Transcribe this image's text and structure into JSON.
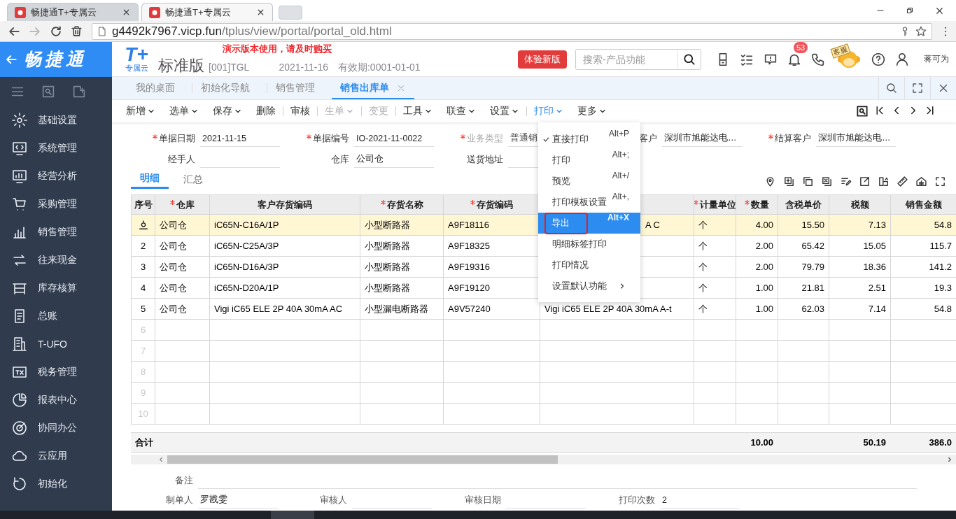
{
  "browser": {
    "tabs": [
      {
        "title": "畅捷通T+专属云",
        "selected": false
      },
      {
        "title": "畅捷通T+专属云",
        "selected": true
      }
    ],
    "url_host": "g4492k7967.vicp.fun",
    "url_path": "/tplus/view/portal/portal_old.html"
  },
  "header": {
    "brand": "畅捷通",
    "product_mark": "T+",
    "product_sub": "专属云",
    "edition": "标准版",
    "account": "[001]TGL",
    "date": "2021-11-16",
    "validity": "有效期:0001-01-01",
    "notice": "演示版本使用，请及时",
    "notice_link": "购买",
    "new_version_button": "体验新版",
    "search": {
      "placeholder": "搜索-产品功能"
    },
    "notification_count": "53",
    "support_label": "客服",
    "user_name": "蒋可为"
  },
  "sidebar": {
    "items": [
      {
        "label": "基础设置"
      },
      {
        "label": "系统管理"
      },
      {
        "label": "经营分析"
      },
      {
        "label": "采购管理"
      },
      {
        "label": "销售管理"
      },
      {
        "label": "往来现金"
      },
      {
        "label": "库存核算"
      },
      {
        "label": "总账"
      },
      {
        "label": "T-UFO"
      },
      {
        "label": "税务管理"
      },
      {
        "label": "报表中心"
      },
      {
        "label": "协同办公"
      },
      {
        "label": "云应用"
      },
      {
        "label": "初始化"
      }
    ]
  },
  "tabs": [
    {
      "label": "我的桌面",
      "selected": false,
      "closable": false
    },
    {
      "label": "初始化导航",
      "selected": false,
      "closable": false
    },
    {
      "label": "销售管理",
      "selected": false,
      "closable": false
    },
    {
      "label": "销售出库单",
      "selected": true,
      "closable": true
    }
  ],
  "toolbar": [
    {
      "label": "新增",
      "dropdown": true,
      "disabled": false,
      "selected": false,
      "separator_before": false
    },
    {
      "label": "选单",
      "dropdown": true,
      "disabled": false,
      "selected": false,
      "separator_before": false
    },
    {
      "label": "保存",
      "dropdown": true,
      "disabled": false,
      "selected": false,
      "separator_before": false
    },
    {
      "label": "删除",
      "dropdown": false,
      "disabled": false,
      "selected": false,
      "separator_before": false
    },
    {
      "label": "审核",
      "dropdown": false,
      "disabled": false,
      "selected": false,
      "separator_before": true
    },
    {
      "label": "生单",
      "dropdown": true,
      "disabled": true,
      "selected": false,
      "separator_before": true
    },
    {
      "label": "变更",
      "dropdown": false,
      "disabled": true,
      "selected": false,
      "separator_before": true
    },
    {
      "label": "工具",
      "dropdown": true,
      "disabled": false,
      "selected": false,
      "separator_before": true
    },
    {
      "label": "联查",
      "dropdown": true,
      "disabled": false,
      "selected": false,
      "separator_before": false
    },
    {
      "label": "设置",
      "dropdown": true,
      "disabled": false,
      "selected": false,
      "separator_before": false
    },
    {
      "label": "打印",
      "dropdown": true,
      "disabled": false,
      "selected": true,
      "separator_before": true
    },
    {
      "label": "更多",
      "dropdown": true,
      "disabled": false,
      "selected": false,
      "separator_before": false
    }
  ],
  "form": {
    "rows": [
      [
        {
          "label": "单据日期",
          "required": true,
          "disabled": false,
          "value": "2021-11-15"
        },
        {
          "label": "单据编号",
          "required": true,
          "disabled": false,
          "value": "IO-2021-11-0022"
        },
        {
          "label": "业务类型",
          "required": true,
          "disabled": true,
          "value": "普通销"
        },
        {
          "label": "客户",
          "disabled": false,
          "value": "深圳市旭能达电…"
        },
        {
          "label": "结算客户",
          "required": true,
          "disabled": false,
          "value": "深圳市旭能达电…"
        }
      ],
      [
        {
          "label": "经手人",
          "required": false,
          "disabled": false
        },
        {
          "label": "仓库",
          "required": false,
          "disabled": false,
          "value": "公司仓"
        },
        {
          "label": "送货地址",
          "required": false,
          "disabled": false
        }
      ]
    ]
  },
  "detail_tabs": [
    {
      "label": "明细",
      "selected": true
    },
    {
      "label": "汇总",
      "selected": false
    }
  ],
  "table": {
    "columns": [
      {
        "label": "序号",
        "required": false
      },
      {
        "label": "仓库",
        "required": true
      },
      {
        "label": "客户存货编码",
        "required": false
      },
      {
        "label": "存货名称",
        "required": true
      },
      {
        "label": "存货编码",
        "required": true
      },
      {},
      {
        "label": "计量单位",
        "required": true
      },
      {
        "label": "数量",
        "required": true
      },
      {
        "label": "含税单价",
        "required": false
      },
      {
        "label": "税额",
        "required": false
      },
      {
        "label": "销售金额",
        "required": false
      }
    ],
    "rows": [
      {
        "selected": true,
        "cells": [
          "公司仓",
          "iC65N-C16A/1P",
          "小型断路器",
          "A9F18116",
          "A C",
          "个",
          "4.00",
          "15.50",
          "7.13",
          "54.8"
        ]
      },
      {
        "no": "2",
        "selected": false,
        "cells": [
          "公司仓",
          "iC65N-C25A/3P",
          "小型断路器",
          "A9F18325",
          null,
          "个",
          "2.00",
          "65.42",
          "15.05",
          "115.7"
        ]
      },
      {
        "no": "3",
        "selected": false,
        "cells": [
          "公司仓",
          "iC65N-D16A/3P",
          "小型断路器",
          "A9F19316",
          null,
          "个",
          "2.00",
          "79.79",
          "18.36",
          "141.2"
        ]
      },
      {
        "no": "4",
        "selected": false,
        "cells": [
          "公司仓",
          "iC65N-D20A/1P",
          "小型断路器",
          "A9F19120",
          null,
          "个",
          "1.00",
          "21.81",
          "2.51",
          "19.3"
        ]
      },
      {
        "no": "5",
        "selected": false,
        "cells": [
          "公司仓",
          "Vigi iC65 ELE 2P 40A 30mA AC",
          "小型漏电断路器",
          "A9V57240",
          "Vigi iC65 ELE 2P 40A 30mA A-t",
          "个",
          "1.00",
          "62.03",
          "7.14",
          "54.8"
        ]
      },
      {
        "no": "6",
        "selected": false
      },
      {
        "no": "7",
        "selected": false
      },
      {
        "no": "8",
        "selected": false
      },
      {
        "no": "9",
        "selected": false
      },
      {
        "no": "10",
        "selected": false
      }
    ],
    "totals": {
      "label": "合计",
      "quantity": "10.00",
      "tax": "50.19",
      "amount": "386.0"
    }
  },
  "print_menu": {
    "items": [
      {
        "label": "直接打印",
        "shortcut": "Alt+P",
        "checked": true,
        "selected": false,
        "outlined": false,
        "submenu": false
      },
      {
        "label": "打印",
        "shortcut": "Alt+;",
        "checked": false,
        "selected": false,
        "outlined": false,
        "submenu": false
      },
      {
        "label": "预览",
        "shortcut": "Alt+/",
        "checked": false,
        "selected": false,
        "outlined": false,
        "submenu": false
      },
      {
        "label": "打印模板设置",
        "shortcut": "Alt+,",
        "checked": false,
        "selected": false,
        "outlined": false,
        "submenu": false
      },
      {
        "label": "导出",
        "shortcut": "Alt+X",
        "checked": false,
        "selected": true,
        "outlined": true,
        "submenu": false
      },
      {
        "label": "明细标签打印",
        "checked": false,
        "selected": false,
        "outlined": false,
        "submenu": false
      },
      {
        "label": "打印情况",
        "checked": false,
        "selected": false,
        "outlined": false,
        "submenu": false
      },
      {
        "label": "设置默认功能",
        "checked": false,
        "selected": false,
        "outlined": false,
        "submenu": true
      }
    ]
  },
  "footer": {
    "remark_label": "备注",
    "fields": [
      {
        "label": "制单人",
        "value": "罗戡雯"
      },
      {
        "label": "审核人"
      },
      {
        "label": "审核日期"
      },
      {
        "label": "打印次数",
        "value": "2"
      }
    ]
  }
}
